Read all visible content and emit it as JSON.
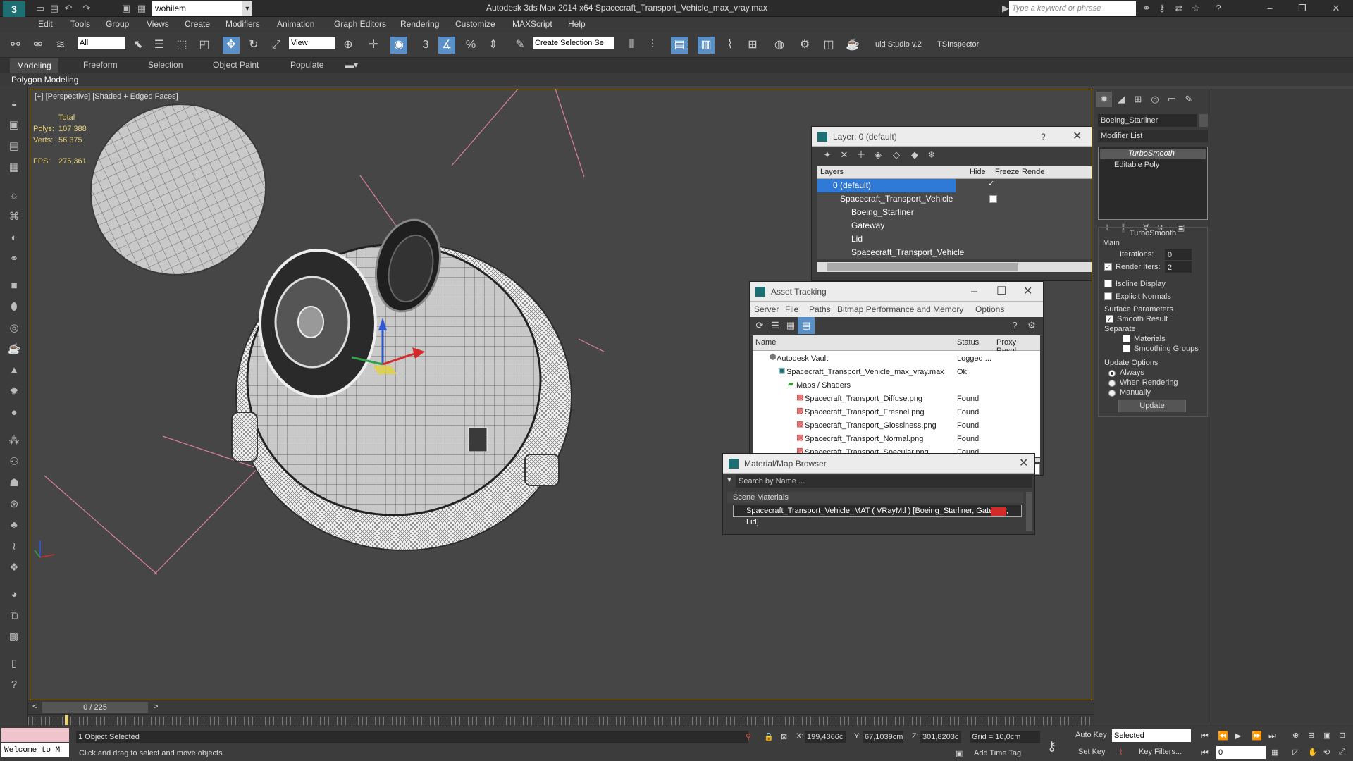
{
  "titlebar": {
    "workspace": "wohilem",
    "title": "Autodesk 3ds Max  2014 x64     Spacecraft_Transport_Vehicle_max_vray.max",
    "search_placeholder": "Type a keyword or phrase",
    "logo": "3"
  },
  "menubar": [
    "Edit",
    "Tools",
    "Group",
    "Views",
    "Create",
    "Modifiers",
    "Animation",
    "Graph Editors",
    "Rendering",
    "Customize",
    "MAXScript",
    "Help"
  ],
  "toolbar": {
    "selection_filter": "All",
    "ref_coord": "View",
    "selection_set_placeholder": "Create Selection Se",
    "studio_label": "uid Studio v.2",
    "inspector_label": "TSInspector"
  },
  "ribbon": {
    "tabs": [
      "Modeling",
      "Freeform",
      "Selection",
      "Object Paint",
      "Populate"
    ],
    "active_tab": "Modeling",
    "subpanel": "Polygon Modeling"
  },
  "viewport": {
    "label": "[+] [Perspective] [Shaded + Edged Faces]",
    "stats": {
      "total_label": "Total",
      "polys_label": "Polys:",
      "polys": "107 388",
      "verts_label": "Verts:",
      "verts": "56 375",
      "fps_label": "FPS:",
      "fps": "275,361"
    }
  },
  "layer_dialog": {
    "title": "Layer: 0 (default)",
    "help": "?",
    "columns": [
      "Layers",
      "Hide",
      "Freeze",
      "Rende"
    ],
    "rows": [
      {
        "name": "0 (default)",
        "level": 0,
        "selected": true
      },
      {
        "name": "Spacecraft_Transport_Vehicle",
        "level": 0,
        "selected": false
      },
      {
        "name": "Boeing_Starliner",
        "level": 1,
        "selected": false
      },
      {
        "name": "Gateway",
        "level": 1,
        "selected": false
      },
      {
        "name": "Lid",
        "level": 1,
        "selected": false
      },
      {
        "name": "Spacecraft_Transport_Vehicle",
        "level": 1,
        "selected": false
      }
    ]
  },
  "asset_tracking": {
    "title": "Asset Tracking",
    "menu": [
      "Server",
      "File",
      "Paths",
      "Bitmap Performance and Memory",
      "Options"
    ],
    "columns": [
      "Name",
      "Status",
      "Proxy Resol..."
    ],
    "rows": [
      {
        "name": "Autodesk Vault",
        "status": "Logged ...",
        "level": 0
      },
      {
        "name": "Spacecraft_Transport_Vehicle_max_vray.max",
        "status": "Ok",
        "level": 1
      },
      {
        "name": "Maps / Shaders",
        "status": "",
        "level": 2
      },
      {
        "name": "Spacecraft_Transport_Diffuse.png",
        "status": "Found",
        "level": 3
      },
      {
        "name": "Spacecraft_Transport_Fresnel.png",
        "status": "Found",
        "level": 3
      },
      {
        "name": "Spacecraft_Transport_Glossiness.png",
        "status": "Found",
        "level": 3
      },
      {
        "name": "Spacecraft_Transport_Normal.png",
        "status": "Found",
        "level": 3
      },
      {
        "name": "Spacecraft_Transport_Specular.png",
        "status": "Found",
        "level": 3
      }
    ]
  },
  "material_browser": {
    "title": "Material/Map Browser",
    "search_placeholder": "Search by Name ...",
    "section": "Scene Materials",
    "item": "Spacecraft_Transport_Vehicle_MAT ( VRayMtl ) [Boeing_Starliner, Gateway, Lid]"
  },
  "command_panel": {
    "object_name": "Boeing_Starliner",
    "modifier_list": "Modifier List",
    "stack": [
      "TurboSmooth",
      "Editable Poly"
    ],
    "rollout_title": "TurboSmooth",
    "main_label": "Main",
    "iterations_label": "Iterations:",
    "iterations": "0",
    "render_iters_label": "Render Iters:",
    "render_iters": "2",
    "isoline": "Isoline Display",
    "explicit_normals": "Explicit Normals",
    "surface_params": "Surface Parameters",
    "smooth_result": "Smooth Result",
    "separate": "Separate",
    "materials": "Materials",
    "smoothing_groups": "Smoothing Groups",
    "update_options": "Update Options",
    "always": "Always",
    "when_rendering": "When Rendering",
    "manually": "Manually",
    "update_button": "Update"
  },
  "timeline": {
    "frame": "0 / 225",
    "prev": "<",
    "next": ">"
  },
  "statusbar": {
    "maxscript": "Welcome to M",
    "selection": "1 Object Selected",
    "prompt": "Click and drag to select and move objects",
    "x_label": "X:",
    "x": "199,4366c",
    "y_label": "Y:",
    "y": "67,1039cm",
    "z_label": "Z:",
    "z": "301,8203c",
    "grid": "Grid = 10,0cm",
    "add_time_tag": "Add Time Tag",
    "auto_key": "Auto Key",
    "set_key": "Set Key",
    "selected": "Selected",
    "key_filters": "Key Filters...",
    "frame_field": "0"
  }
}
